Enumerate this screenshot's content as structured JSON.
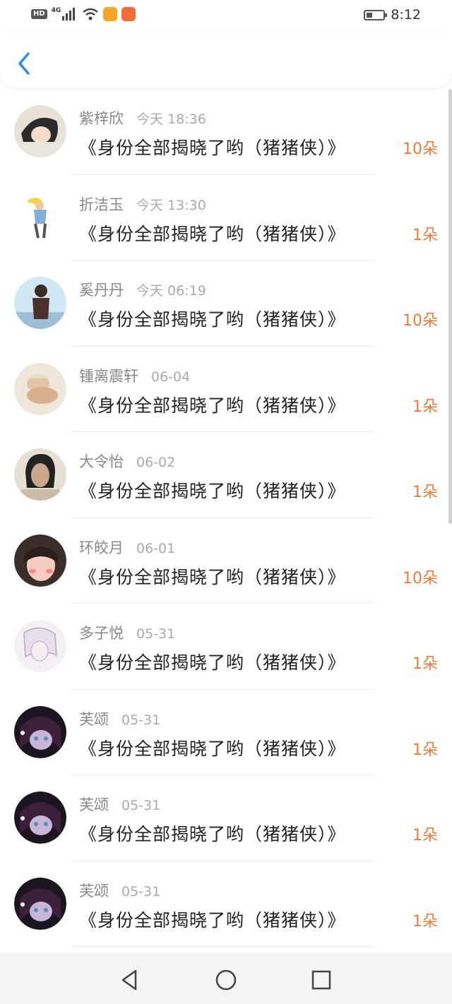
{
  "status_bar": {
    "hd": "HD",
    "network": "4G",
    "time": "8:12",
    "icons": [
      "signal-icon",
      "wifi-icon",
      "weibo-icon",
      "app-icon",
      "battery-icon"
    ]
  },
  "header": {
    "back_icon": "chevron-left-icon"
  },
  "colors": {
    "accent": "#2a8ef0",
    "gift": "#f07a3c",
    "name": "#888888",
    "time": "#aaaaaa"
  },
  "rows": [
    {
      "name": "紫梓欣",
      "time": "今天 18:36",
      "message": "《身份全部揭晓了哟（猪猪侠）》",
      "gift": "10朵",
      "avatar": "anime-avatar"
    },
    {
      "name": "折洁玉",
      "time": "今天 13:30",
      "message": "《身份全部揭晓了哟（猪猪侠）》",
      "gift": "1朵",
      "avatar": "cartoon-figure-avatar"
    },
    {
      "name": "奚丹丹",
      "time": "今天 06:19",
      "message": "《身份全部揭晓了哟（猪猪侠）》",
      "gift": "10朵",
      "avatar": "girl-illustration-avatar"
    },
    {
      "name": "锺离震轩",
      "time": "06-04",
      "message": "《身份全部揭晓了哟（猪猪侠）》",
      "gift": "1朵",
      "avatar": "photo-avatar"
    },
    {
      "name": "大令怡",
      "time": "06-02",
      "message": "《身份全部揭晓了哟（猪猪侠）》",
      "gift": "1朵",
      "avatar": "portrait-avatar"
    },
    {
      "name": "环皎月",
      "time": "06-01",
      "message": "《身份全部揭晓了哟（猪猪侠）》",
      "gift": "10朵",
      "avatar": "selfie-avatar"
    },
    {
      "name": "多子悦",
      "time": "05-31",
      "message": "《身份全部揭晓了哟（猪猪侠）》",
      "gift": "1朵",
      "avatar": "sketch-avatar"
    },
    {
      "name": "芙颂",
      "time": "05-31",
      "message": "《身份全部揭晓了哟（猪猪侠）》",
      "gift": "1朵",
      "avatar": "dark-anime-avatar"
    },
    {
      "name": "芙颂",
      "time": "05-31",
      "message": "《身份全部揭晓了哟（猪猪侠）》",
      "gift": "1朵",
      "avatar": "dark-anime-avatar"
    },
    {
      "name": "芙颂",
      "time": "05-31",
      "message": "《身份全部揭晓了哟（猪猪侠）》",
      "gift": "1朵",
      "avatar": "dark-anime-avatar"
    }
  ],
  "navbar": {
    "icons": [
      "back-triangle-icon",
      "home-circle-icon",
      "recents-square-icon"
    ]
  }
}
